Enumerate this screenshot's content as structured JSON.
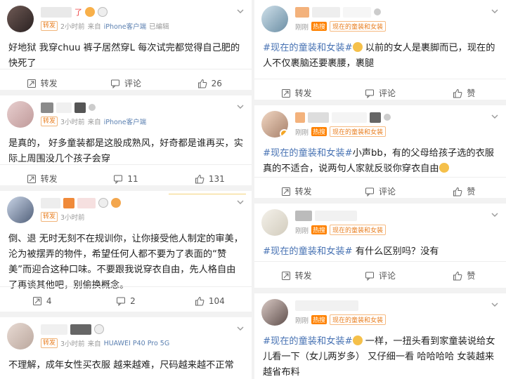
{
  "labels": {
    "repost": "转发",
    "comment": "评论",
    "like": "赞",
    "from": "来自",
    "edited": "已编辑",
    "fan_tag": "转发"
  },
  "left_posts": [
    {
      "time": "2小时前",
      "source": "iPhone客户端",
      "edited": "已编辑",
      "fan_tag": "转发",
      "text": "好地狱 我穿chuu 裤子居然穿L  每次试完都觉得自己肥的快死了",
      "repost": "转发",
      "comment": "评论",
      "like": "26"
    },
    {
      "time": "3小时前",
      "source": "iPhone客户端",
      "fan_tag": "转发",
      "text": "是真的， 好多童装都是这股成熟风，好奇都是谁再买，实际上周围没几个孩子会穿",
      "repost": "转发",
      "comment": "11",
      "like": "131"
    },
    {
      "time": "3小时前",
      "fan_tag": "转发",
      "text": "倒、退 无时无刻不在规训你，让你接受他人制定的审美，沦为被摆弄的物件，希望任何人都不要为了表面的“赞美”而迎合这种口味。不要跟我说穿衣自由，先人格自由了再谈其他吧，别偷换概念。",
      "repost": "4",
      "comment": "2",
      "like": "104"
    },
    {
      "time": "3小时前",
      "source": "HUAWEI P40 Pro 5G",
      "fan_tag": "转发",
      "text": "不理解，成年女性买衣服 越来越难，尺码越来越不正常"
    }
  ],
  "right_posts": [
    {
      "time": "刚刚",
      "hot": "热搜",
      "topic_tag": "现在的童装和女装",
      "topic": "#现在的童装和女装#",
      "text": " 以前的女人是裹脚而已，现在的人不仅裹脑还要裹腰，裹腿",
      "repost": "转发",
      "comment": "评论",
      "like": "赞"
    },
    {
      "time": "刚刚",
      "hot": "热搜",
      "topic_tag": "现在的童装和女装",
      "topic": "#现在的童装和女装#",
      "text": "小声bb，有的父母给孩子选的衣服真的不适合，说两句人家就反驳你穿衣自由",
      "repost": "转发",
      "comment": "评论",
      "like": "赞"
    },
    {
      "time": "刚刚",
      "hot": "热搜",
      "topic_tag": "现在的童装和女装",
      "topic": "#现在的童装和女装#",
      "text": " 有什么区别吗？没有",
      "repost": "转发",
      "comment": "评论",
      "like": "赞"
    },
    {
      "time": "刚刚",
      "hot": "热搜",
      "topic_tag": "现在的童装和女装",
      "topic": "#现在的童装和女装#",
      "text": " 一样，一扭头看到家童装说给女儿看一下（女儿两岁多） 又仔细一看 哈哈哈哈 女装越来越省布料"
    }
  ],
  "colors": {
    "link_blue": "#4a74b4",
    "orange": "#ff8200",
    "source_blue": "#5a7fb0"
  },
  "icons": [
    "repost-icon",
    "comment-icon",
    "like-icon",
    "chevron-down-icon"
  ]
}
